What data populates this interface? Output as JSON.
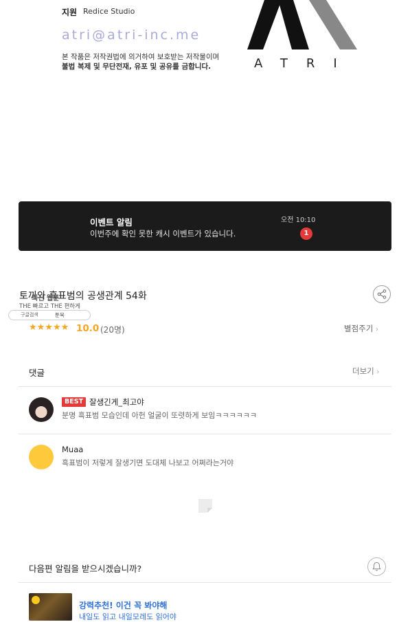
{
  "credits": {
    "support_label": "지원",
    "support_value": "Redice Studio",
    "email": "atri@atri-inc.me",
    "notice_line1": "본 작품은 저작권법에 의거하여 보호받는 저작물이며",
    "notice_line2": "불법 복제 및 무단전재, 유포 및 공유를 금합니다.",
    "logo_word": "ATRI"
  },
  "notification": {
    "title": "이벤트 알림",
    "message": "이번주에 확인 못한 캐시 이벤트가 있습니다.",
    "time": "오전 10:10",
    "badge_count": "1"
  },
  "episode": {
    "title": "토끼와 흑표범의 공생관계 54화",
    "rating_stars": "★★★★★",
    "rating_score": "10.0",
    "rating_count": "(20명)",
    "rate_button": "별점주기"
  },
  "watermark": {
    "line1": "최신 웹툰",
    "line2": "THE 빠르고 THE 편하게",
    "search_label": "구글검색",
    "brand": "툰북"
  },
  "comments": {
    "header": "댓글",
    "more_label": "더보기",
    "items": [
      {
        "badge": "BEST",
        "user": "잘생긴게_최고야",
        "text": "분명 흑표범 모습인데 아헌 얼굴이 또렷하게 보임ㅋㅋㅋㅋㅋㅋ"
      },
      {
        "user": "Muaa",
        "text": "흑표범이 저렇게 잘생기면 도대체 나보고 어쩌라는거야"
      }
    ]
  },
  "subscribe": {
    "question": "다음편 알림을 받으시겠습니까?"
  },
  "recommendation": {
    "title": "강력추천! 이건 꼭 봐야해",
    "subtitle": "내일도 읽고 내일모레도 읽어야"
  },
  "colors": {
    "accent_orange": "#f5a623",
    "best_red": "#e53a3a",
    "link_blue": "#2f6fd8",
    "notif_bg": "#1b1b1b"
  }
}
